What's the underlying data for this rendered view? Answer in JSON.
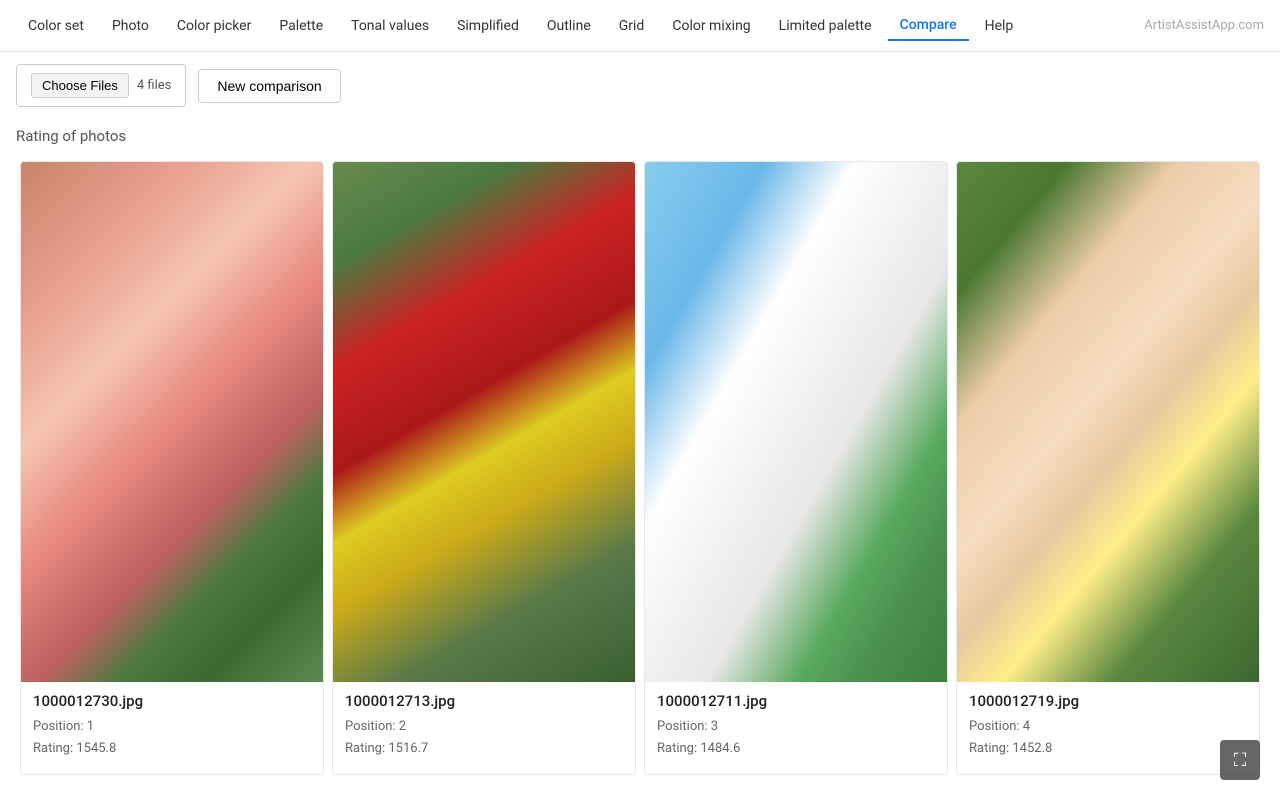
{
  "nav": {
    "items": [
      {
        "id": "color-set",
        "label": "Color set",
        "active": false
      },
      {
        "id": "photo",
        "label": "Photo",
        "active": false
      },
      {
        "id": "color-picker",
        "label": "Color picker",
        "active": false
      },
      {
        "id": "palette",
        "label": "Palette",
        "active": false
      },
      {
        "id": "tonal-values",
        "label": "Tonal values",
        "active": false
      },
      {
        "id": "simplified",
        "label": "Simplified",
        "active": false
      },
      {
        "id": "outline",
        "label": "Outline",
        "active": false
      },
      {
        "id": "grid",
        "label": "Grid",
        "active": false
      },
      {
        "id": "color-mixing",
        "label": "Color mixing",
        "active": false
      },
      {
        "id": "limited-palette",
        "label": "Limited palette",
        "active": false
      },
      {
        "id": "compare",
        "label": "Compare",
        "active": true
      },
      {
        "id": "help",
        "label": "Help",
        "active": false
      }
    ],
    "logo": "ArtistAssistApp.com"
  },
  "toolbar": {
    "choose_files_label": "Choose Files",
    "file_count": "4 files",
    "new_comparison_label": "New comparison"
  },
  "section": {
    "title": "Rating of photos"
  },
  "photos": [
    {
      "filename": "1000012730.jpg",
      "position": "Position: 1",
      "rating": "Rating: 1545.8",
      "thumb_class": "thumb-1"
    },
    {
      "filename": "1000012713.jpg",
      "position": "Position: 2",
      "rating": "Rating: 1516.7",
      "thumb_class": "thumb-2"
    },
    {
      "filename": "1000012711.jpg",
      "position": "Position: 3",
      "rating": "Rating: 1484.6",
      "thumb_class": "thumb-3"
    },
    {
      "filename": "1000012719.jpg",
      "position": "Position: 4",
      "rating": "Rating: 1452.8",
      "thumb_class": "thumb-4"
    }
  ]
}
